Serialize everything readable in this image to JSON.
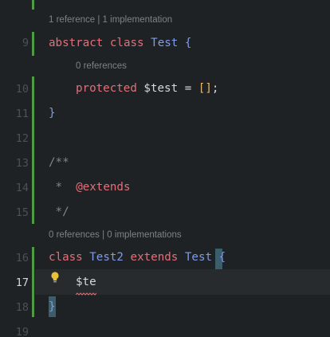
{
  "editor": {
    "hints": {
      "class_test": "1 reference | 1 implementation",
      "property_test": "0 references",
      "class_test2": "0 references | 0 implementations"
    },
    "lines": {
      "n9": "9",
      "n10": "10",
      "n11": "11",
      "n12": "12",
      "n13": "13",
      "n14": "14",
      "n15": "15",
      "n16": "16",
      "n17": "17",
      "n18": "18",
      "n19": "19"
    },
    "code": {
      "l9_abstract": "abstract",
      "l9_class": "class",
      "l9_name": "Test",
      "l9_brace": "{",
      "l10_protected": "protected",
      "l10_var": "$test",
      "l10_eq": "=",
      "l10_arr": "[]",
      "l10_semi": ";",
      "l11_close": "}",
      "l13_doc_open": "/**",
      "l14_star": "*",
      "l14_tag": "@extends",
      "l15_doc_close": "*/",
      "l16_class": "class",
      "l16_name": "Test2",
      "l16_extends": "extends",
      "l16_parent": "Test",
      "l16_brace": "{",
      "l17_typed": "$te",
      "l18_close": "}"
    },
    "colors": {
      "background": "#1f2225",
      "current_line": "#282b2e",
      "keyword": "#e0707a",
      "class_name": "#7f9be6",
      "change_marker": "#4f9a45",
      "bracket_highlight": "#3b5f6a",
      "error_squiggle": "#e0707a",
      "bulb": "#e8c33a"
    },
    "icons": {
      "intention_bulb": "lightbulb-icon"
    }
  }
}
